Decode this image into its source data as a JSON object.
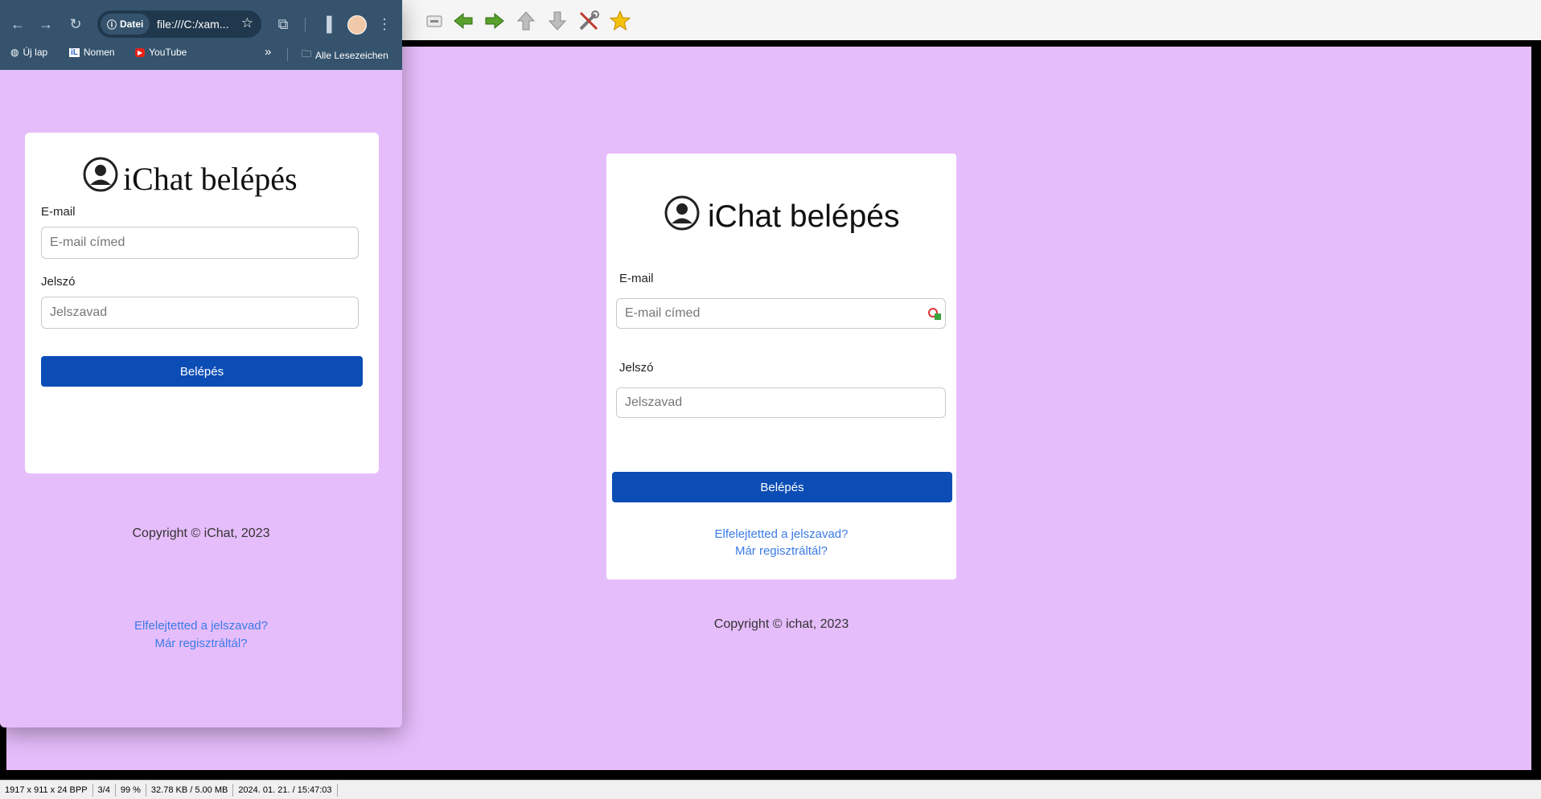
{
  "viewer": {
    "toolbar_icons": [
      "zoom-out-icon",
      "arrow-left-icon",
      "arrow-right-icon",
      "arrow-up-icon",
      "arrow-down-icon",
      "tools-icon",
      "star-icon"
    ],
    "status": [
      "1917 x 911 x 24 BPP",
      "3/4",
      "99 %",
      "32.78 KB / 5.00 MB",
      "2024. 01. 21. / 15:47:03"
    ]
  },
  "browser": {
    "site_chip": "Datei",
    "url": "file:///C:/xam...",
    "bookmarks": [
      "Új lap",
      "Nomen",
      "YouTube"
    ],
    "all_bookmarks": "Alle Lesezeichen",
    "more": "»"
  },
  "login_left": {
    "title": "iChat belépés",
    "email_label": "E-mail",
    "email_placeholder": "E-mail címed",
    "password_label": "Jelszó",
    "password_placeholder": "Jelszavad",
    "submit": "Belépés",
    "copyright": "Copyright © iChat, 2023",
    "forgot": "Elfelejtetted a jelszavad?",
    "registered": "Már regisztráltál?"
  },
  "login_right": {
    "title": "iChat belépés",
    "email_label": "E-mail",
    "email_placeholder": "E-mail címed",
    "password_label": "Jelszó",
    "password_placeholder": "Jelszavad",
    "submit": "Belépés",
    "forgot": "Elfelejtetted a jelszavad?",
    "registered": "Már regisztráltál?",
    "copyright": "Copyright © ichat, 2023"
  },
  "colors": {
    "page_bg": "#e6bdfb",
    "button": "#0b4db5",
    "link": "#3b7be6",
    "chrome": "#35536d"
  }
}
